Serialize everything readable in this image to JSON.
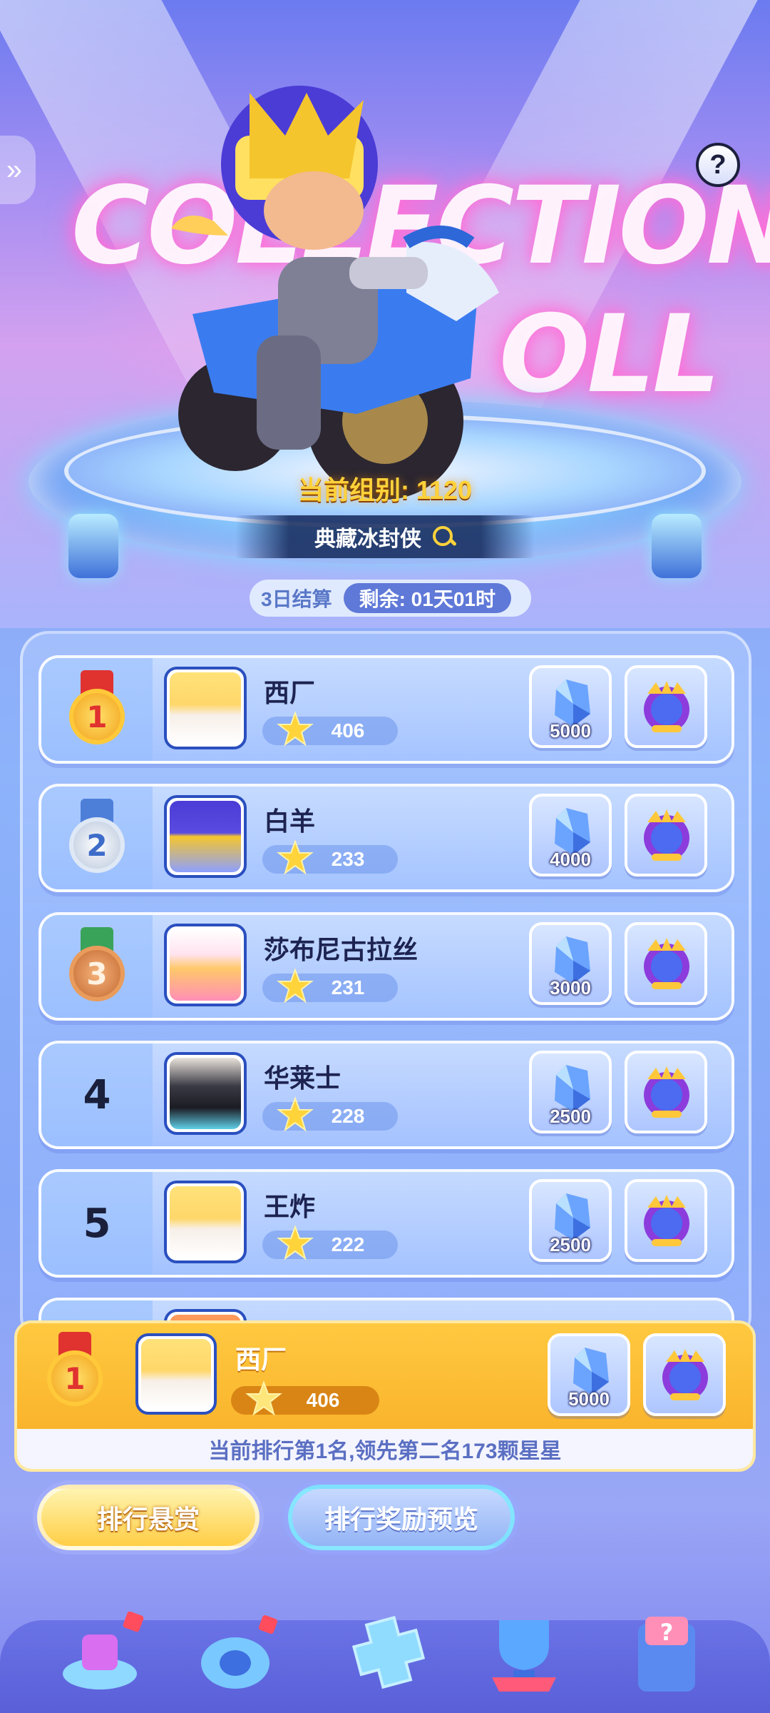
{
  "hero": {
    "deco_line1": "COLLECTION",
    "deco_line2": "OLL",
    "group_label": "当前组别: 1120",
    "item_name": "典藏冰封侠",
    "settle_label": "3日结算",
    "remaining": "剩余: 01天01时"
  },
  "leaderboard": [
    {
      "rank": "1",
      "medal": "gold",
      "name": "西厂",
      "stars": "406",
      "gem_amount": "5000"
    },
    {
      "rank": "2",
      "medal": "silver",
      "name": "白羊",
      "stars": "233",
      "gem_amount": "4000"
    },
    {
      "rank": "3",
      "medal": "bronze",
      "name": "莎布尼古拉丝",
      "stars": "231",
      "gem_amount": "3000"
    },
    {
      "rank": "4",
      "medal": "",
      "name": "华莱士",
      "stars": "228",
      "gem_amount": "2500"
    },
    {
      "rank": "5",
      "medal": "",
      "name": "王炸",
      "stars": "222",
      "gem_amount": "2500"
    }
  ],
  "mine": {
    "rank": "1",
    "name": "西厂",
    "stars": "406",
    "gem_amount": "5000",
    "note": "当前排行第1名,领先第二名173颗星星"
  },
  "tabs": {
    "rank_bounty": "排行悬赏",
    "reward_preview": "排行奖励预览"
  },
  "icons": [
    "help-icon",
    "back-arrow-icon",
    "search-icon",
    "star-icon",
    "gem-icon",
    "avatar-frame-icon"
  ],
  "colors": {
    "gold": "#ffc940",
    "accent_blue": "#5f79d8",
    "label_yellow": "#ffd23a"
  }
}
